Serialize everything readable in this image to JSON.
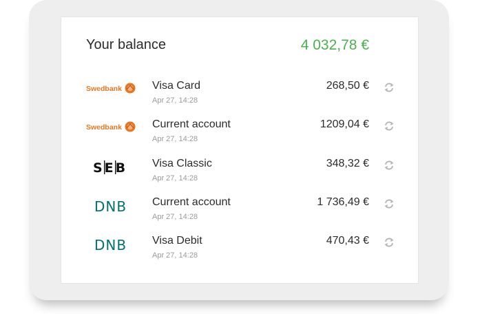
{
  "balance": {
    "label": "Your balance",
    "total": "4 032,78 €",
    "total_color": "#4caf50"
  },
  "accounts": [
    {
      "bank": "Swedbank",
      "logo": "swedbank-logo",
      "name": "Visa Card",
      "updated": "Apr 27, 14:28",
      "amount": "268,50 €",
      "refresh_icon": "refresh-icon"
    },
    {
      "bank": "Swedbank",
      "logo": "swedbank-logo",
      "name": "Current account",
      "updated": "Apr 27, 14:28",
      "amount": "1209,04 €",
      "refresh_icon": "refresh-icon"
    },
    {
      "bank": "SEB",
      "logo": "seb-logo",
      "name": "Visa Classic",
      "updated": "Apr 27, 14:28",
      "amount": "348,32 €",
      "refresh_icon": "refresh-icon"
    },
    {
      "bank": "DNB",
      "logo": "dnb-logo",
      "name": "Current account",
      "updated": "Apr 27, 14:28",
      "amount": "1 736,49 €",
      "refresh_icon": "refresh-icon"
    },
    {
      "bank": "DNB",
      "logo": "dnb-logo",
      "name": "Visa Debit",
      "updated": "Apr 27, 14:28",
      "amount": "470,43 €",
      "refresh_icon": "refresh-icon"
    }
  ],
  "colors": {
    "swedbank": "#e8761f",
    "dnb": "#007272",
    "seb": "#111111"
  }
}
